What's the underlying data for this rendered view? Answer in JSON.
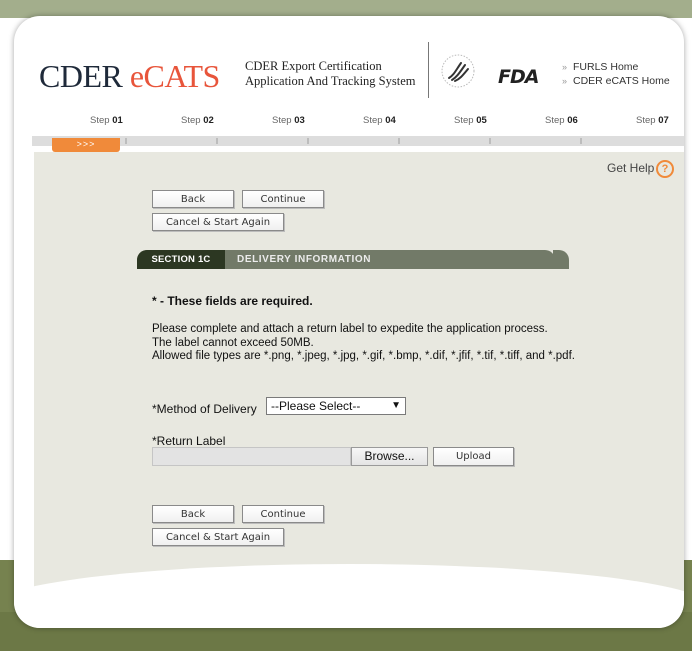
{
  "header": {
    "app_name_prefix": "CDER ",
    "app_name_accent": "eCATS",
    "system_name_line1": "CDER Export Certification",
    "system_name_line2": "Application And Tracking System",
    "links": [
      {
        "label": "FURLS Home"
      },
      {
        "label": "CDER eCATS Home"
      }
    ]
  },
  "steps": [
    {
      "prefix": "Step ",
      "num": "01"
    },
    {
      "prefix": "Step ",
      "num": "02"
    },
    {
      "prefix": "Step ",
      "num": "03"
    },
    {
      "prefix": "Step ",
      "num": "04"
    },
    {
      "prefix": "Step ",
      "num": "05"
    },
    {
      "prefix": "Step ",
      "num": "06"
    },
    {
      "prefix": "Step ",
      "num": "07"
    }
  ],
  "progress": {
    "indicator": ">>>",
    "current_step": 1
  },
  "help": {
    "label": "Get Help",
    "icon_glyph": "?"
  },
  "buttons": {
    "back": "Back",
    "continue": "Continue",
    "cancel": "Cancel & Start Again"
  },
  "section": {
    "tag": "SECTION 1C",
    "title": "DELIVERY INFORMATION"
  },
  "form": {
    "required_note": "* - These fields are required.",
    "instructions": [
      "Please complete and attach a return label to expedite the application process.",
      "The label cannot exceed 50MB.",
      "Allowed file types are *.png, *.jpeg, *.jpg, *.gif, *.bmp, *.dif, *.jfif, *.tif, *.tiff, and *.pdf."
    ],
    "method_label": "*Method of Delivery",
    "method_selected": "--Please Select--",
    "return_label": "*Return Label",
    "browse": "Browse...",
    "upload": "Upload"
  },
  "colors": {
    "accent": "#e8553b",
    "progress": "#f08a3a",
    "section_dark": "#2c3722",
    "section_tab": "#727a68",
    "content_bg": "#e8e8e0",
    "frame_band": "#76824f"
  },
  "icons": {
    "help": "help-circle-icon",
    "chevron": "double-chevron-icon",
    "dropdown": "chevron-down-icon"
  }
}
